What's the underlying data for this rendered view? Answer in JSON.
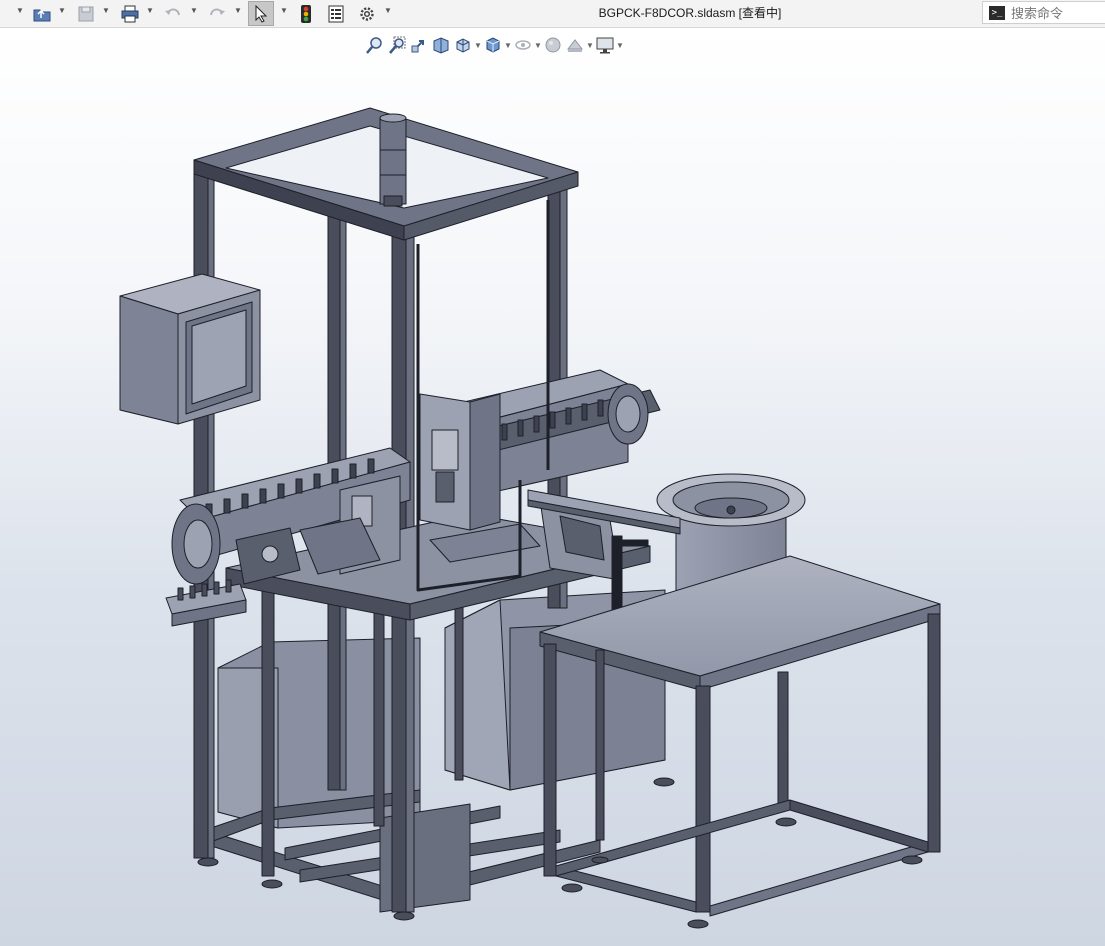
{
  "window": {
    "title": "BGPCK-F8DCOR.sldasm [查看中]"
  },
  "search": {
    "placeholder": "搜索命令"
  },
  "toolbar": {
    "icons": [
      "new-document-icon",
      "open-folder-icon",
      "save-icon",
      "print-icon",
      "undo-icon",
      "redo-icon",
      "select-arrow-icon",
      "traffic-light-icon",
      "file-properties-icon",
      "options-gear-icon"
    ]
  },
  "heads_up_toolbar": {
    "icons": [
      "zoom-to-fit-icon",
      "zoom-to-area-icon",
      "previous-view-icon",
      "section-view-icon",
      "view-orientation-icon",
      "display-style-icon",
      "hide-show-items-icon",
      "edit-appearance-icon",
      "apply-scene-icon",
      "view-settings-icon"
    ]
  },
  "colors": {
    "frame": "#4a4e5c",
    "metal_light": "#8d92a3",
    "metal_mid": "#6f7486",
    "panel": "#9ea3b4",
    "outline": "#1e2029"
  }
}
